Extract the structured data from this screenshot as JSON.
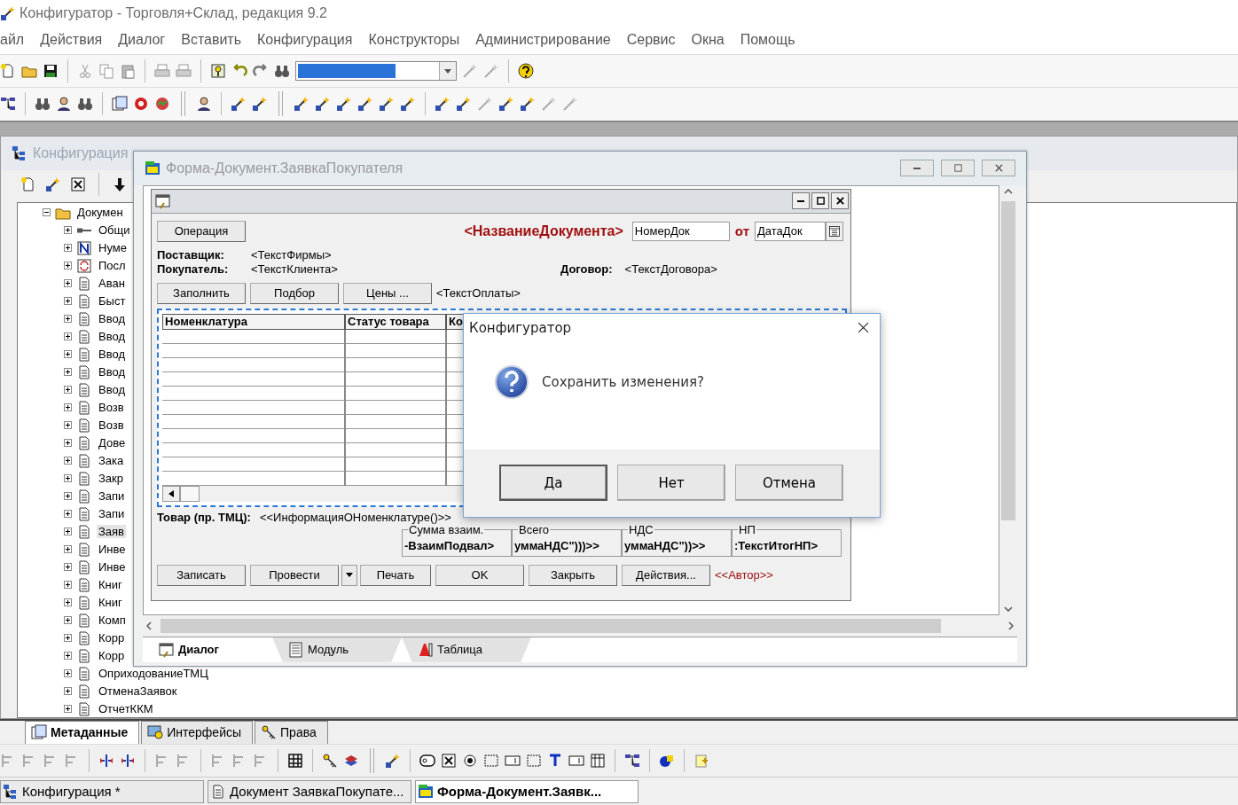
{
  "app": {
    "title": "Конфигуратор - Торговля+Склад, редакция 9.2"
  },
  "menu": [
    "айл",
    "Действия",
    "Диалог",
    "Вставить",
    "Конфигурация",
    "Конструкторы",
    "Администрирование",
    "Сервис",
    "Окна",
    "Помощь"
  ],
  "config_window": {
    "title": "Конфигурация",
    "tree": {
      "label": "Докумен",
      "expanded": true,
      "children": [
        {
          "label": "Общи",
          "kind": "general",
          "expanded": false,
          "selected": false
        },
        {
          "label": "Нуме",
          "kind": "numerator",
          "expanded": false,
          "selected": false
        },
        {
          "label": "Посл",
          "kind": "sequence",
          "expanded": false,
          "selected": false
        },
        {
          "label": "Аван",
          "kind": "document",
          "expanded": false,
          "selected": false
        },
        {
          "label": "Быст",
          "kind": "document",
          "expanded": false,
          "selected": false
        },
        {
          "label": "Ввод",
          "kind": "document",
          "expanded": false,
          "selected": false
        },
        {
          "label": "Ввод",
          "kind": "document",
          "expanded": false,
          "selected": false
        },
        {
          "label": "Ввод",
          "kind": "document",
          "expanded": false,
          "selected": false
        },
        {
          "label": "Ввод",
          "kind": "document",
          "expanded": false,
          "selected": false
        },
        {
          "label": "Ввод",
          "kind": "document",
          "expanded": false,
          "selected": false
        },
        {
          "label": "Возв",
          "kind": "document",
          "expanded": false,
          "selected": false
        },
        {
          "label": "Возв",
          "kind": "document",
          "expanded": false,
          "selected": false
        },
        {
          "label": "Дове",
          "kind": "document",
          "expanded": false,
          "selected": false
        },
        {
          "label": "Зака",
          "kind": "document",
          "expanded": false,
          "selected": false
        },
        {
          "label": "Закр",
          "kind": "document",
          "expanded": false,
          "selected": false
        },
        {
          "label": "Запи",
          "kind": "document",
          "expanded": false,
          "selected": false
        },
        {
          "label": "Запи",
          "kind": "document",
          "expanded": false,
          "selected": false
        },
        {
          "label": "Заяв",
          "kind": "document",
          "expanded": false,
          "selected": true
        },
        {
          "label": "Инве",
          "kind": "document",
          "expanded": false,
          "selected": false
        },
        {
          "label": "Инве",
          "kind": "document",
          "expanded": false,
          "selected": false
        },
        {
          "label": "Книг",
          "kind": "document",
          "expanded": false,
          "selected": false
        },
        {
          "label": "Книг",
          "kind": "document",
          "expanded": false,
          "selected": false
        },
        {
          "label": "Комп",
          "kind": "document",
          "expanded": false,
          "selected": false
        },
        {
          "label": "Корр",
          "kind": "document",
          "expanded": false,
          "selected": false
        },
        {
          "label": "Корр",
          "kind": "document",
          "expanded": false,
          "selected": false
        },
        {
          "label": "ОприходованиеТМЦ",
          "kind": "document",
          "expanded": false,
          "selected": false
        },
        {
          "label": "ОтменаЗаявок",
          "kind": "document",
          "expanded": false,
          "selected": false
        },
        {
          "label": "ОтчетККМ",
          "kind": "document",
          "expanded": false,
          "selected": false
        }
      ]
    }
  },
  "form_window": {
    "title": "Форма-Документ.ЗаявкаПокупателя",
    "form": {
      "operation_button": "Операция",
      "doc_title": "<НазваниеДокумента>",
      "number_field": "НомерДок",
      "date_prefix": "от",
      "date_field": "ДатаДок",
      "parties": [
        {
          "label": "Поставщик:",
          "value": "<ТекстФирмы>"
        },
        {
          "label": "Покупатель:",
          "value": "<ТекстКлиента>"
        }
      ],
      "contract": {
        "label": "Договор:",
        "value": "<ТекстДоговора>"
      },
      "fill_buttons": [
        "Заполнить",
        "Подбор",
        "Цены ..."
      ],
      "payment_text": "<ТекстОплаты>",
      "table": {
        "columns": [
          "Номенклатура",
          "Статус товара",
          "Ко"
        ]
      },
      "item_info": {
        "label": "Товар (пр. ТМЦ):",
        "value": "<<ИнформацияОНоменклатуре()>>"
      },
      "totals": [
        {
          "caption": "Сумма взаим.",
          "value": "-ВзаимПодвал>"
        },
        {
          "caption": "Всего",
          "value": "уммаНДС\")))>>"
        },
        {
          "caption": "НДС",
          "value": "уммаНДС\"))>>"
        },
        {
          "caption": "НП",
          "value": ":ТекстИтогНП>"
        }
      ],
      "action_buttons": [
        {
          "kind": "button",
          "label": "Записать"
        },
        {
          "kind": "button",
          "label": "Провести"
        },
        {
          "kind": "dropdown"
        },
        {
          "kind": "button",
          "label": "Печать"
        },
        {
          "kind": "button",
          "label": "OK"
        },
        {
          "kind": "button",
          "label": "Закрыть"
        },
        {
          "kind": "button",
          "label": "Действия..."
        }
      ],
      "author": "<<Автор>>"
    },
    "tabs": [
      {
        "label": "Диалог",
        "kind": "dialog",
        "selected": true
      },
      {
        "label": "Модуль",
        "kind": "module",
        "selected": false
      },
      {
        "label": "Таблица",
        "kind": "table",
        "selected": false
      }
    ]
  },
  "dialog": {
    "title": "Конфигуратор",
    "message": "Сохранить изменения?",
    "buttons": [
      {
        "label": "Да",
        "default": true
      },
      {
        "label": "Нет",
        "default": false
      },
      {
        "label": "Отмена",
        "default": false
      }
    ]
  },
  "bottom_tabs": [
    {
      "label": "Метаданные",
      "kind": "metadata",
      "selected": true
    },
    {
      "label": "Интерфейсы",
      "kind": "interfaces",
      "selected": false
    },
    {
      "label": "Права",
      "kind": "rights",
      "selected": false
    }
  ],
  "taskbar": [
    {
      "label": "Конфигурация *",
      "kind": "configuration",
      "selected": false
    },
    {
      "label": "Документ ЗаявкаПокупате...",
      "kind": "document",
      "selected": false
    },
    {
      "label": "Форма-Документ.Заявк...",
      "kind": "form",
      "selected": true
    }
  ]
}
